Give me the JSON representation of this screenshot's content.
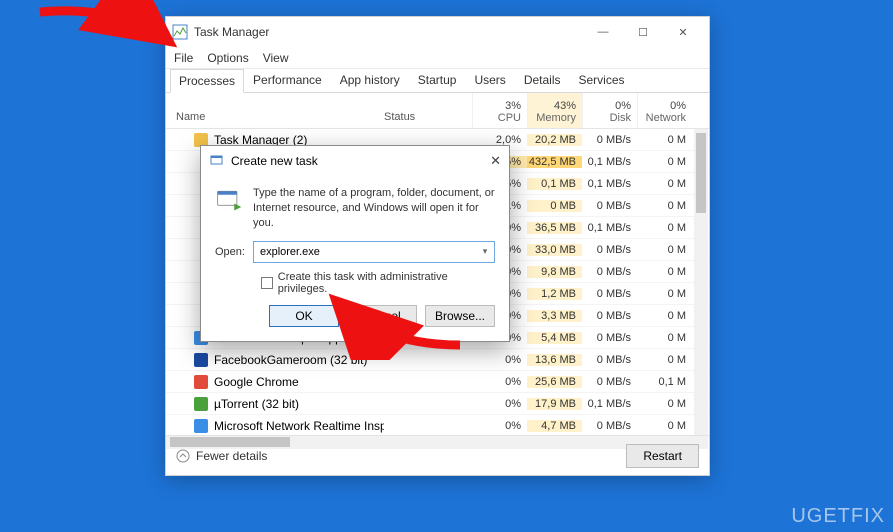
{
  "window": {
    "title": "Task Manager",
    "menu": {
      "file": "File",
      "options": "Options",
      "view": "View"
    },
    "controls": {
      "min": "—",
      "max": "☐",
      "close": "✕"
    }
  },
  "tabs": {
    "processes": "Processes",
    "performance": "Performance",
    "apphistory": "App history",
    "startup": "Startup",
    "users": "Users",
    "details": "Details",
    "services": "Services"
  },
  "columns": {
    "name": "Name",
    "status": "Status",
    "cpu_pct": "3%",
    "cpu": "CPU",
    "mem_pct": "43%",
    "mem": "Memory",
    "disk_pct": "0%",
    "disk": "Disk",
    "net_pct": "0%",
    "net": "Network"
  },
  "rows": [
    {
      "name": "Task Manager (2)",
      "cpu": "2,0%",
      "mem": "20,2 MB",
      "disk": "0 MB/s",
      "net": "0 M",
      "icon": "#f2c04a"
    },
    {
      "name": "",
      "cpu": "0,5%",
      "mem": "432,5 MB",
      "disk": "0,1 MB/s",
      "net": "0 M",
      "icon": "",
      "hl": true
    },
    {
      "name": "",
      "cpu": "0,5%",
      "mem": "0,1 MB",
      "disk": "0,1 MB/s",
      "net": "0 M",
      "icon": ""
    },
    {
      "name": "",
      "cpu": "0,1%",
      "mem": "0 MB",
      "disk": "0 MB/s",
      "net": "0 M",
      "icon": ""
    },
    {
      "name": "",
      "cpu": "0%",
      "mem": "36,5 MB",
      "disk": "0,1 MB/s",
      "net": "0 M",
      "icon": ""
    },
    {
      "name": "",
      "cpu": "0%",
      "mem": "33,0 MB",
      "disk": "0 MB/s",
      "net": "0 M",
      "icon": ""
    },
    {
      "name": "",
      "cpu": "0%",
      "mem": "9,8 MB",
      "disk": "0 MB/s",
      "net": "0 M",
      "icon": ""
    },
    {
      "name": "",
      "cpu": "0%",
      "mem": "1,2 MB",
      "disk": "0 MB/s",
      "net": "0 M",
      "icon": ""
    },
    {
      "name": "",
      "cpu": "0%",
      "mem": "3,3 MB",
      "disk": "0 MB/s",
      "net": "0 M",
      "icon": ""
    },
    {
      "name": "Microsoft Text Input Application",
      "cpu": "0%",
      "mem": "5,4 MB",
      "disk": "0 MB/s",
      "net": "0 M",
      "icon": "#3a8ee6"
    },
    {
      "name": "FacebookGameroom (32 bit)",
      "cpu": "0%",
      "mem": "13,6 MB",
      "disk": "0 MB/s",
      "net": "0 M",
      "icon": "#1a4aa0"
    },
    {
      "name": "Google Chrome",
      "cpu": "0%",
      "mem": "25,6 MB",
      "disk": "0 MB/s",
      "net": "0,1 M",
      "icon": "#e24a3b"
    },
    {
      "name": "µTorrent (32 bit)",
      "cpu": "0%",
      "mem": "17,9 MB",
      "disk": "0,1 MB/s",
      "net": "0 M",
      "icon": "#4aa03b"
    },
    {
      "name": "Microsoft Network Realtime Inspectio...",
      "cpu": "0%",
      "mem": "4,7 MB",
      "disk": "0 MB/s",
      "net": "0 M",
      "icon": "#3a8ee6"
    }
  ],
  "footer": {
    "fewer": "Fewer details",
    "restart": "Restart"
  },
  "dialog": {
    "title": "Create new task",
    "desc": "Type the name of a program, folder, document, or Internet resource, and Windows will open it for you.",
    "open_label": "Open:",
    "value": "explorer.exe",
    "admin": "Create this task with administrative privileges.",
    "ok": "OK",
    "cancel": "Cancel",
    "browse": "Browse..."
  },
  "watermark": "UGETFIX"
}
